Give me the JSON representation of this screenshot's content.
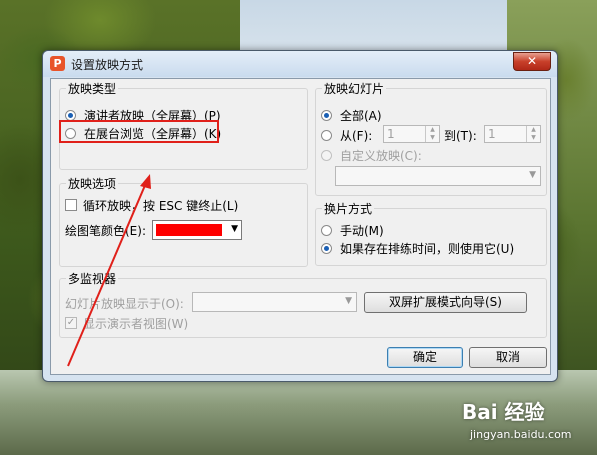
{
  "dialog": {
    "title": "设置放映方式",
    "app_icon": "P",
    "close_glyph": "✕"
  },
  "show_type": {
    "title": "放映类型",
    "options": [
      {
        "label": "演讲者放映（全屏幕）(P)",
        "checked": true
      },
      {
        "label": "在展台浏览（全屏幕）(K)",
        "checked": false
      }
    ]
  },
  "slides": {
    "title": "放映幻灯片",
    "all_label": "全部(A)",
    "from_label": "从(F):",
    "from_value": "1",
    "to_label": "到(T):",
    "to_value": "1",
    "custom_label": "自定义放映(C):",
    "custom_value": ""
  },
  "options": {
    "title": "放映选项",
    "loop_label": "循环放映，按 ESC 键终止(L)",
    "pen_color_label": "绘图笔颜色(E):",
    "pen_color": "#ff0000"
  },
  "advance": {
    "title": "换片方式",
    "manual_label": "手动(M)",
    "timing_label": "如果存在排练时间，则使用它(U)"
  },
  "monitors": {
    "title": "多监视器",
    "display_on_label": "幻灯片放映显示于(O):",
    "display_on_value": "",
    "wizard_button": "双屏扩展模式向导(S)",
    "presenter_view_label": "显示演示者视图(W)"
  },
  "buttons": {
    "ok": "确定",
    "cancel": "取消"
  },
  "watermark": {
    "logo": "Bai 经验",
    "url": "jingyan.baidu.com"
  },
  "colors": {
    "annotation": "#e0201a",
    "radio_selected": "#1a5fb4"
  },
  "icons": [
    "app-icon",
    "close-icon",
    "spin-up-icon",
    "spin-down-icon",
    "dropdown-arrow-icon",
    "checkmark-icon",
    "annotation-arrow"
  ]
}
